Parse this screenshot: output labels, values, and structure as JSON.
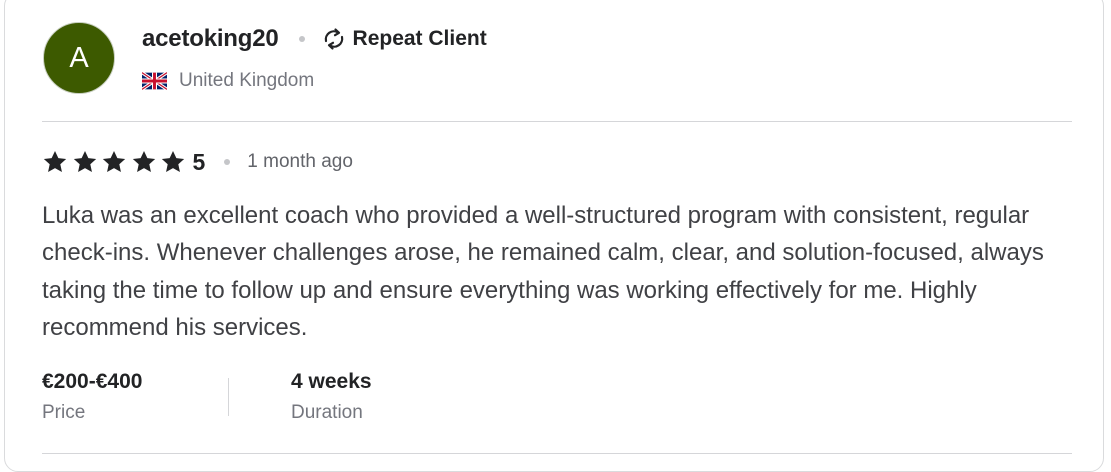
{
  "reviewer": {
    "avatar_initial": "A",
    "avatar_color": "#3d5a00",
    "username": "acetoking20",
    "badge_icon": "repeat-icon",
    "badge_label": "Repeat Client",
    "country_flag": "uk-flag-icon",
    "country": "United Kingdom"
  },
  "review": {
    "rating_value": "5",
    "stars_filled": 5,
    "stars_total": 5,
    "time_ago": "1 month ago",
    "text": "Luka was an excellent coach who provided a well-structured program with consistent, regular check-ins. Whenever challenges arose, he remained calm, clear, and solution-focused, always taking the time to follow up and ensure everything was working effectively for me. Highly recommend his services."
  },
  "details": {
    "price_value": "€200-€400",
    "price_label": "Price",
    "duration_value": "4 weeks",
    "duration_label": "Duration"
  }
}
